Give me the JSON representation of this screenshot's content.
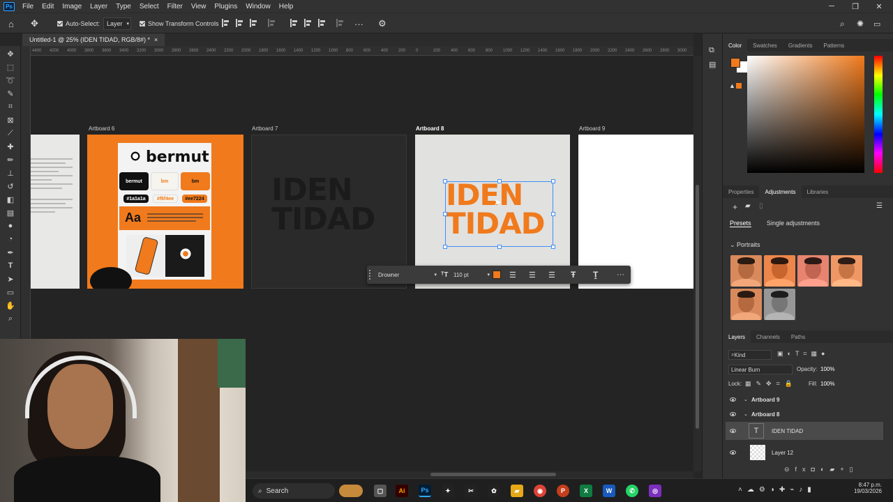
{
  "app": {
    "logo": "Ps"
  },
  "menu": [
    "File",
    "Edit",
    "Image",
    "Layer",
    "Type",
    "Select",
    "Filter",
    "View",
    "Plugins",
    "Window",
    "Help"
  ],
  "window_controls": {
    "minimize": "─",
    "restore": "❐",
    "close": "✕"
  },
  "options_bar": {
    "auto_select_label": "Auto-Select:",
    "auto_select_value": "Layer",
    "show_transform_label": "Show Transform Controls",
    "more": "···"
  },
  "document": {
    "tab_title": "Untitled-1 @ 25% (IDEN TIDAD, RGB/8#) *",
    "close": "×"
  },
  "ruler_ticks": [
    "4400",
    "4200",
    "4000",
    "3800",
    "3600",
    "3400",
    "3200",
    "3000",
    "2800",
    "2600",
    "2400",
    "2200",
    "2000",
    "1800",
    "1600",
    "1400",
    "1200",
    "1000",
    "800",
    "600",
    "400",
    "200",
    "0",
    "200",
    "400",
    "600",
    "800",
    "1000",
    "1200",
    "1400",
    "1600",
    "1800",
    "2000",
    "2200",
    "2400",
    "2600",
    "2800",
    "3000"
  ],
  "artboards": {
    "ab6": {
      "label": "Artboard 6",
      "brand": "bermut",
      "pill1": "bermut",
      "pill2": "bm",
      "pill3": "bm",
      "hex1": "#1a1a1a",
      "hex2": "#f6f4ee",
      "hex3": "#ee7224",
      "aa": "Aa"
    },
    "ab7": {
      "label": "Artboard 7",
      "text_line1": "IDEN",
      "text_line2": "TIDAD"
    },
    "ab8": {
      "label": "Artboard 8",
      "text_line1": "IDEN",
      "text_line2": "TIDAD"
    },
    "ab9": {
      "label": "Artboard 9"
    }
  },
  "context_bar": {
    "font": "Drowner",
    "size": "110 pt",
    "color": "#f07a1c",
    "more": "···"
  },
  "color_panel": {
    "tabs": [
      "Color",
      "Swatches",
      "Gradients",
      "Patterns"
    ],
    "foreground": "#f07a1c",
    "background": "#ffffff"
  },
  "adjustments_panel": {
    "tabs": [
      "Properties",
      "Adjustments",
      "Libraries"
    ],
    "subtabs": [
      "Presets",
      "Single adjustments"
    ],
    "group": "Portraits"
  },
  "layers_panel": {
    "tabs": [
      "Layers",
      "Channels",
      "Paths"
    ],
    "filter_kind": "Kind",
    "blend_mode": "Linear Burn",
    "opacity_label": "Opacity:",
    "opacity_value": "100%",
    "lock_label": "Lock:",
    "fill_label": "Fill:",
    "fill_value": "100%",
    "layers": [
      {
        "name": "Artboard 9",
        "type": "artboard"
      },
      {
        "name": "Artboard 8",
        "type": "artboard"
      },
      {
        "name": "IDEN TIDAD",
        "type": "text",
        "selected": true
      },
      {
        "name": "Layer 12",
        "type": "pixel"
      }
    ]
  },
  "taskbar": {
    "search_placeholder": "Search",
    "time": "8:47 p.m.",
    "date": "19/03/2026"
  }
}
